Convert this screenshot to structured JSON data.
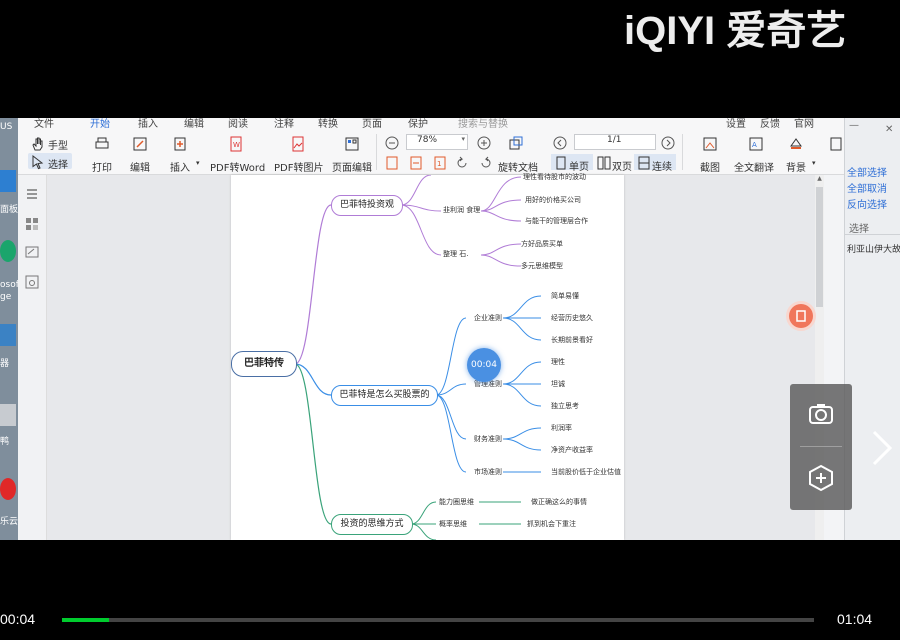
{
  "brand": "iQIYI 爱奇艺",
  "player": {
    "current": "00:04",
    "duration": "01:04",
    "progress": 0.0625,
    "overlay_timer": "00:04"
  },
  "colors": {
    "accent": "#00cc2e",
    "timer": "#4a90e2",
    "purple": "#b07cd6",
    "blue": "#3a8ee6",
    "green": "#3aa37a"
  },
  "desktop": {
    "labels": [
      "US",
      "面板",
      "osoft",
      "ge",
      "器",
      "鸭",
      "乐云网"
    ]
  },
  "menubar": {
    "items": [
      "文件",
      "开始",
      "插入",
      "编辑",
      "阅读",
      "注释",
      "转换",
      "页面",
      "保护",
      "搜索与替换",
      "设置",
      "反馈",
      "官网"
    ]
  },
  "toolbar": {
    "hand": "手型",
    "select": "选择",
    "print": "打印",
    "edit": "编辑",
    "insert": "插入",
    "pdf_word": "PDF转Word",
    "pdf_image": "PDF转图片",
    "page_edit": "页面编辑",
    "zoom": "78%",
    "page": "1/1",
    "rotate_doc": "旋转文档",
    "single": "单页",
    "double": "双页",
    "continuous": "连续",
    "screenshot": "截图",
    "translate": "全文翻译",
    "background": "背景"
  },
  "right_panel": {
    "items": [
      "全部选择",
      "全部取消",
      "反向选择",
      "选择",
      "利亚山伊大故..."
    ]
  },
  "mindmap": {
    "root": "巴菲特传",
    "top_leaf": "理性看待股市的波动",
    "b1": {
      "label": "巴菲特投资观",
      "s1": {
        "label": "韭利润 食理",
        "items": [
          "用好的价格买公司",
          "与能干的管理层合作"
        ]
      },
      "s2": {
        "label": "整理 石.",
        "items": [
          "方好品质买单",
          "多元思维模型"
        ]
      }
    },
    "b2": {
      "label": "巴菲特是怎么买股票的",
      "s1": {
        "label": "企业准则",
        "items": [
          "简单易懂",
          "经营历史悠久",
          "长期前景看好"
        ]
      },
      "s2": {
        "label": "管理准则",
        "items": [
          "理性",
          "坦诚",
          "独立思考"
        ]
      },
      "s3": {
        "label": "财务准则",
        "items": [
          "利润率",
          "净资产收益率"
        ]
      },
      "s4": {
        "label": "市场准则",
        "items": [
          "当前股价低于企业估值"
        ]
      }
    },
    "b3": {
      "label": "投资的思维方式",
      "s1": {
        "label": "能力圈思维",
        "item": "做正确这么的事情"
      },
      "s2": {
        "label": "概率思维",
        "item": "抓到机会下重注"
      }
    }
  }
}
